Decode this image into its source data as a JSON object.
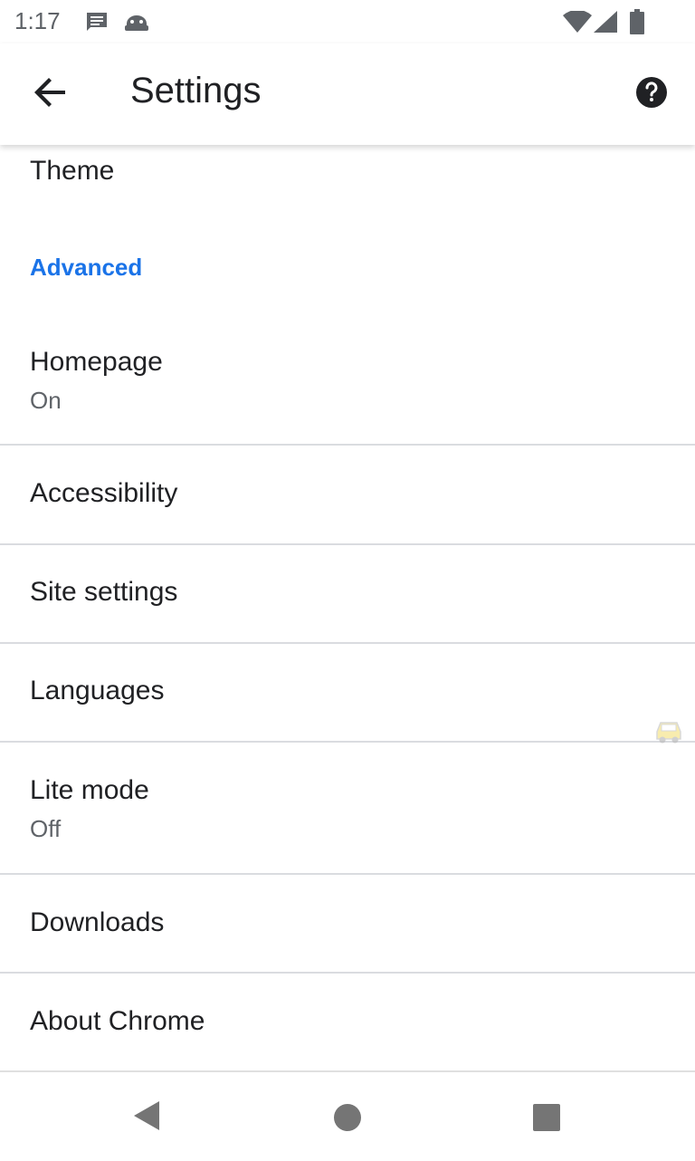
{
  "status_bar": {
    "time": "1:17",
    "icons": [
      "message-icon",
      "android-debug-icon",
      "wifi-icon",
      "signal-icon",
      "battery-icon"
    ]
  },
  "app_bar": {
    "title": "Settings",
    "back_icon": "arrow-back-icon",
    "help_icon": "help-icon"
  },
  "settings": {
    "theme_label": "Theme",
    "advanced_header": "Advanced",
    "items": [
      {
        "label": "Homepage",
        "sub": "On"
      },
      {
        "label": "Accessibility"
      },
      {
        "label": "Site settings"
      },
      {
        "label": "Languages"
      },
      {
        "label": "Lite mode",
        "sub": "Off"
      },
      {
        "label": "Downloads"
      },
      {
        "label": "About Chrome"
      }
    ]
  },
  "colors": {
    "accent": "#1a73e8",
    "text_primary": "#202124",
    "text_secondary": "#5f6368",
    "divider": "#dadce0"
  },
  "nav_bar": {
    "icons": [
      "back-triangle-icon",
      "home-circle-icon",
      "recents-square-icon"
    ]
  }
}
